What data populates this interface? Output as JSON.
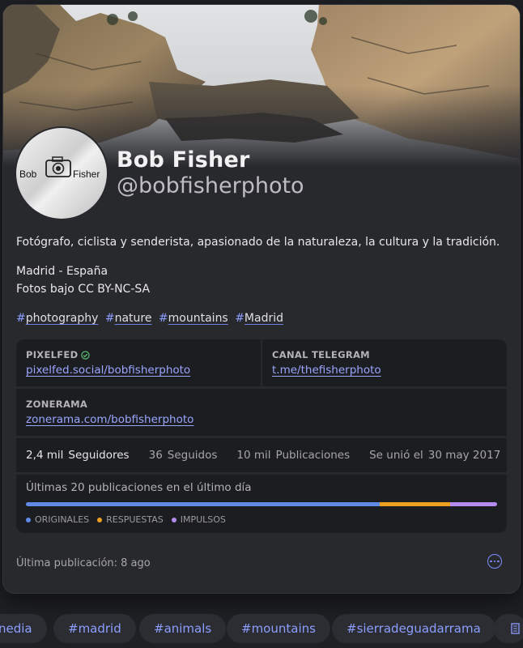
{
  "profile": {
    "name": "Bob Fisher",
    "handle": "@bobfisherphoto",
    "avatar_text_left": "Bob",
    "avatar_text_right": "Fisher"
  },
  "bio": {
    "line1": "Fotógrafo, ciclista y senderista, apasionado de la naturaleza, la cultura y la tradición.",
    "line2": "Madrid - España",
    "line3": "Fotos bajo CC BY-NC-SA",
    "hashtags": [
      "photography",
      "nature",
      "mountains",
      "Madrid"
    ]
  },
  "fields": {
    "pixelfed_label": "PIXELFED",
    "pixelfed_value": "pixelfed.social/bobfisherphoto",
    "telegram_label": "CANAL TELEGRAM",
    "telegram_value": "t.me/thefisherphoto",
    "zonerama_label": "ZONERAMA",
    "zonerama_value": "zonerama.com/bobfisherphoto"
  },
  "stats": {
    "followers_n": "2,4 mil",
    "followers_label": "Seguidores",
    "following_n": "36",
    "following_label": "Seguidos",
    "posts_n": "10 mil",
    "posts_label": "Publicaciones",
    "joined_label": "Se unió el",
    "joined_date": "30 may 2017"
  },
  "activity": {
    "heading": "Últimas 20 publicaciones en el último día",
    "originals_fraction": 0.75,
    "replies_fraction": 0.15,
    "boosts_fraction": 0.1,
    "legend_originals": "ORIGINALES",
    "legend_replies": "RESPUESTAS",
    "legend_boosts": "IMPULSOS",
    "color_originals": "#5f8ae6",
    "color_replies": "#f0a020",
    "color_boosts": "#b48cf0"
  },
  "footer": {
    "last_post": "Última publicación: 8 ago",
    "more_icon": "more-options-icon"
  },
  "chips": {
    "c0": "nedia",
    "c1": "#madrid",
    "c2": "#animals",
    "c3": "#mountains",
    "c4": "#sierradeguadarrama"
  },
  "colors": {
    "accent": "#8c9eff",
    "card_bg": "#28292d",
    "field_bg": "#1c1d21"
  }
}
